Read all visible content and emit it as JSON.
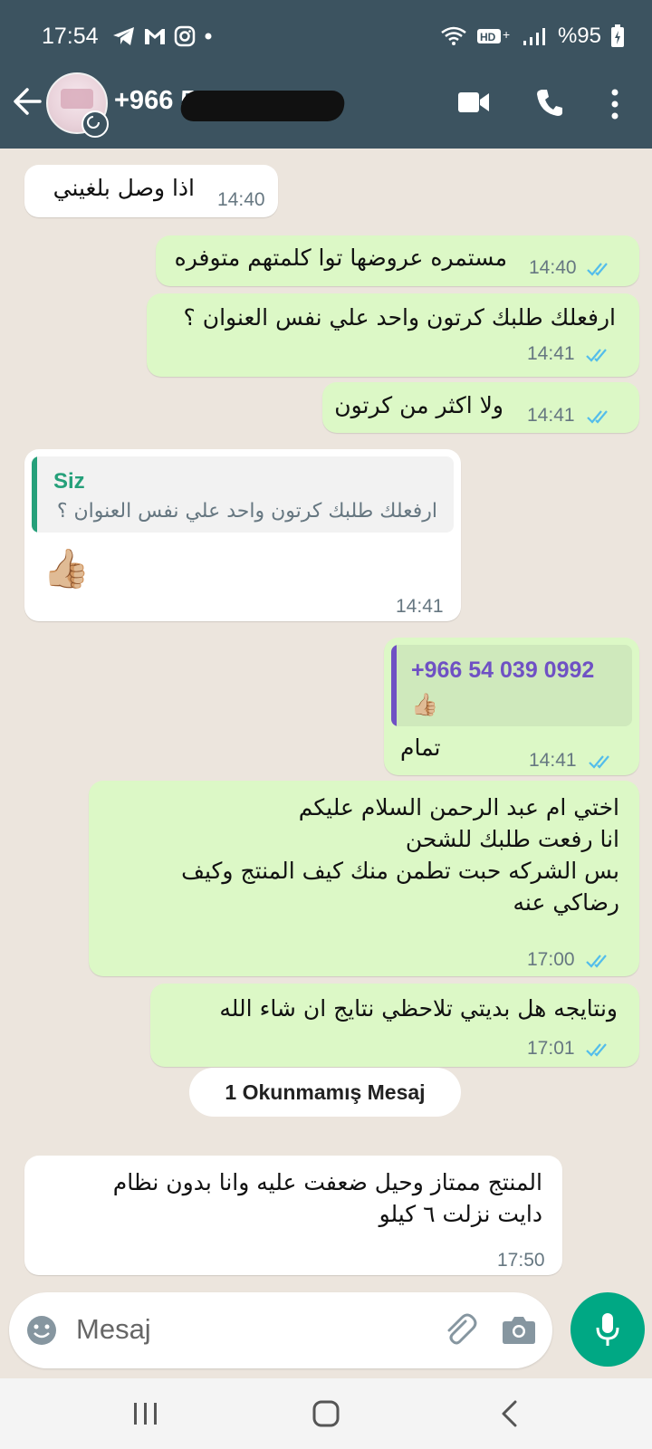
{
  "status_bar": {
    "time": "17:54",
    "battery": "%95"
  },
  "header": {
    "contact_name": "+966 5",
    "icons": [
      "back-arrow-icon",
      "video-call-icon",
      "voice-call-icon",
      "more-vert-icon"
    ]
  },
  "colors": {
    "header_bg": "#3c5360",
    "chat_bg": "#ece5dd",
    "outgoing_bubble": "#dcf8c6",
    "incoming_bubble": "#ffffff",
    "read_ticks": "#53bdeb",
    "accent_green": "#00a884",
    "quote_self": "#25a07a",
    "quote_other": "#6f51c4"
  },
  "messages": [
    {
      "dir": "in",
      "text": "اذا وصل بلغيني",
      "time": "14:40"
    },
    {
      "dir": "out",
      "text": "مستمره عروضها توا كلمتهم متوفره",
      "time": "14:40"
    },
    {
      "dir": "out",
      "text": "ارفعلك طلبك كرتون واحد علي نفس العنوان ؟",
      "time": "14:41"
    },
    {
      "dir": "out",
      "text": "ولا اكثر من كرتون",
      "time": "14:41"
    },
    {
      "dir": "in",
      "quote_name": "Siz",
      "quote_text": "ارفعلك طلبك كرتون واحد علي نفس العنوان ؟",
      "text": "👍🏼",
      "time": "14:41"
    },
    {
      "dir": "out",
      "quote_name": "+966 54 039 0992",
      "quote_text": "👍🏼",
      "text": "تمام",
      "time": "14:41"
    },
    {
      "dir": "out",
      "text": "اختي ام عبد الرحمن السلام عليكم\nانا رفعت طلبك للشحن\nبس الشركه حبت تطمن منك كيف المنتج وكيف\nرضاكي عنه",
      "time": "17:00"
    },
    {
      "dir": "out",
      "text": "ونتايجه هل بديتي تلاحظي نتايج ان شاء الله",
      "time": "17:01"
    },
    {
      "dir": "in",
      "text": "المنتج ممتاز وحيل ضعفت عليه وانا بدون نظام\nدايت نزلت ٦ كيلو",
      "time": "17:50"
    }
  ],
  "unread_label": "1 Okunmamış Mesaj",
  "composer": {
    "placeholder": "Mesaj"
  }
}
